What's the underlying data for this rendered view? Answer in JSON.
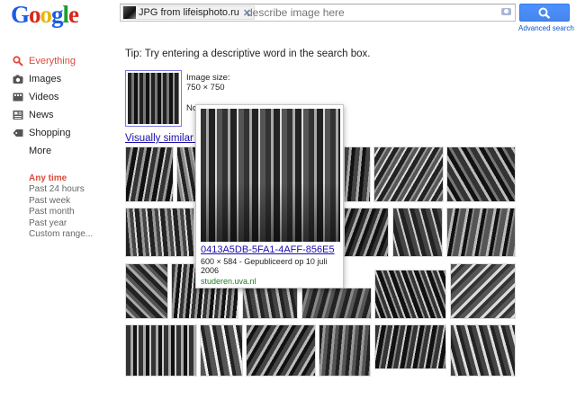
{
  "logo": {
    "letters": [
      "G",
      "o",
      "o",
      "g",
      "l",
      "e"
    ],
    "colors": [
      "#1a5ce6",
      "#d9281a",
      "#e8b60c",
      "#1a5ce6",
      "#1f9c2b",
      "#d9281a"
    ]
  },
  "search": {
    "chip_label": "JPG from lifeisphoto.ru",
    "placeholder": "describe image here",
    "advanced_label": "Advanced search"
  },
  "sidebar": {
    "items": [
      {
        "label": "Everything",
        "icon": "search-icon"
      },
      {
        "label": "Images",
        "icon": "camera-icon"
      },
      {
        "label": "Videos",
        "icon": "film-icon"
      },
      {
        "label": "News",
        "icon": "news-icon"
      },
      {
        "label": "Shopping",
        "icon": "tag-icon"
      }
    ],
    "more_label": "More",
    "time_heading": "Any time",
    "time_filters": [
      "Past 24 hours",
      "Past week",
      "Past month",
      "Past year",
      "Custom range..."
    ]
  },
  "tip": "Tip: Try entering a descriptive word in the search box.",
  "query_image": {
    "size_label": "Image size:",
    "size_value": "750 × 750",
    "partial_text": "No"
  },
  "visually_similar_label": "Visually similar in",
  "popup": {
    "title": "0413A5DB-5FA1-4AFF-856E5",
    "meta": "600 × 584 - Gepubliceerd op 10 juli 2006",
    "host": "studeren.uva.nl"
  },
  "colors": {
    "accent": "#dd4b39",
    "link": "#1a0dab",
    "host": "#1e7d26",
    "button": "#4d90fe"
  }
}
